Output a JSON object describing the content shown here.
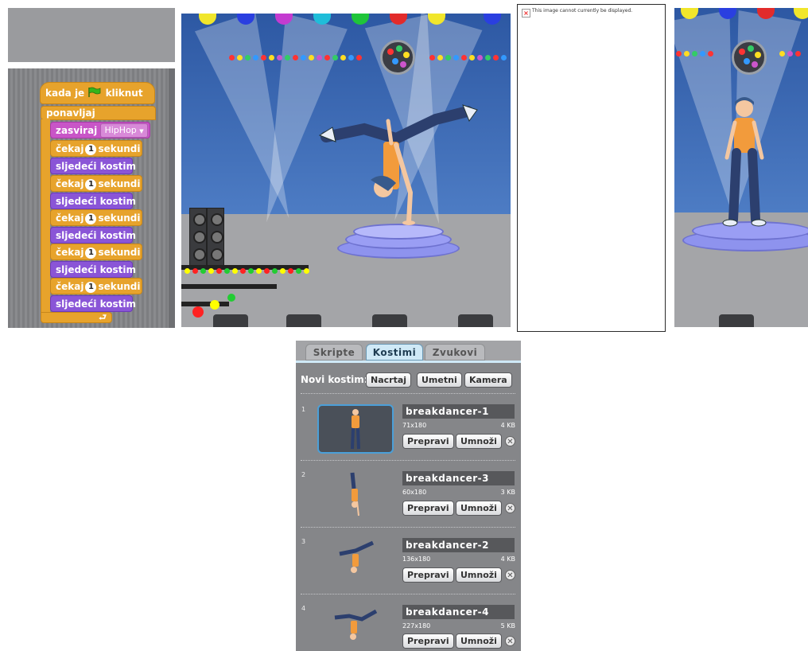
{
  "scripts": {
    "hat": {
      "label": "kada je",
      "suffix": "kliknut",
      "icon": "green-flag-icon"
    },
    "forever": {
      "label": "ponavljaj"
    },
    "sound_block": {
      "label": "zasviraj",
      "value": "HipHop"
    },
    "wait_blocks": [
      {
        "label": "čekaj",
        "value": "1",
        "unit": "sekundi"
      },
      {
        "label": "čekaj",
        "value": "1",
        "unit": "sekundi"
      },
      {
        "label": "čekaj",
        "value": "1",
        "unit": "sekundi"
      },
      {
        "label": "čekaj",
        "value": "1",
        "unit": "sekundi"
      },
      {
        "label": "čekaj",
        "value": "1",
        "unit": "sekundi"
      }
    ],
    "next_costume_blocks": [
      {
        "label": "sljedeći kostim"
      },
      {
        "label": "sljedeći kostim"
      },
      {
        "label": "sljedeći kostim"
      },
      {
        "label": "sljedeći kostim"
      },
      {
        "label": "sljedeći kostim"
      }
    ],
    "colors": {
      "control": "#e7a32c",
      "sound": "#c855c7",
      "looks": "#8a55d7"
    }
  },
  "broken_image": {
    "text": "This image cannot currently be displayed."
  },
  "costume_panel": {
    "tabs": [
      {
        "label": "Skripte",
        "active": false
      },
      {
        "label": "Kostimi",
        "active": true
      },
      {
        "label": "Zvukovi",
        "active": false
      }
    ],
    "new_costume_label": "Novi kostim:",
    "buttons": {
      "paint": "Nacrtaj",
      "import": "Umetni",
      "camera": "Kamera"
    },
    "costumes": [
      {
        "index": "1",
        "name": "breakdancer-1",
        "dims": "71x180",
        "size": "4 KB",
        "edit": "Prepravi",
        "copy": "Umnoži",
        "selected": true
      },
      {
        "index": "2",
        "name": "breakdancer-3",
        "dims": "60x180",
        "size": "3 KB",
        "edit": "Prepravi",
        "copy": "Umnoži",
        "selected": false
      },
      {
        "index": "3",
        "name": "breakdancer-2",
        "dims": "136x180",
        "size": "4 KB",
        "edit": "Prepravi",
        "copy": "Umnoži",
        "selected": false
      },
      {
        "index": "4",
        "name": "breakdancer-4",
        "dims": "227x180",
        "size": "5 KB",
        "edit": "Prepravi",
        "copy": "Umnoži",
        "selected": false
      }
    ],
    "delete_glyph": "✕"
  }
}
